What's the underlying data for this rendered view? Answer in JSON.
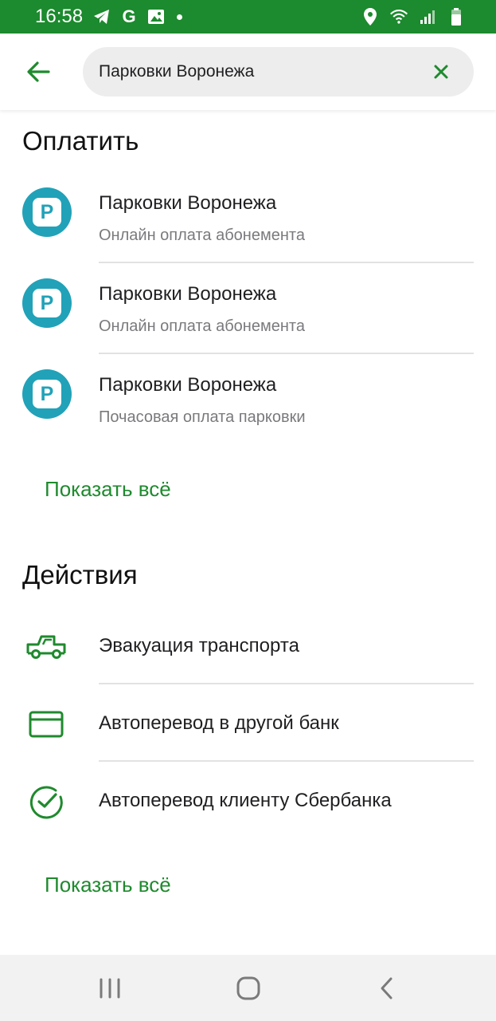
{
  "status_bar": {
    "time": "16:58",
    "left_icons": [
      "telegram-icon",
      "google-icon",
      "image-icon",
      "dot-icon"
    ],
    "right_icons": [
      "location-icon",
      "wifi-icon",
      "signal-icon",
      "battery-icon"
    ],
    "google_glyph": "G"
  },
  "search": {
    "value": "Парковки Воронежа",
    "placeholder": ""
  },
  "pay_section": {
    "title": "Оплатить",
    "items": [
      {
        "title": "Парковки Воронежа",
        "subtitle": "Онлайн оплата абонемента",
        "icon_letter": "P"
      },
      {
        "title": "Парковки Воронежа",
        "subtitle": "Онлайн оплата абонемента",
        "icon_letter": "P"
      },
      {
        "title": "Парковки Воронежа",
        "subtitle": "Почасовая оплата парковки",
        "icon_letter": "P"
      }
    ],
    "show_all": "Показать всё"
  },
  "actions_section": {
    "title": "Действия",
    "items": [
      {
        "title": "Эвакуация транспорта",
        "icon": "tow-truck-icon"
      },
      {
        "title": "Автоперевод в другой банк",
        "icon": "card-icon"
      },
      {
        "title": "Автоперевод клиенту Сбербанка",
        "icon": "check-circle-icon"
      }
    ],
    "show_all": "Показать всё"
  },
  "colors": {
    "status_bar": "#1c8a2e",
    "accent_green": "#1f8a2e",
    "parking_teal": "#21a2b8",
    "nav_bar": "#f2f2f2"
  },
  "nav_bar": {
    "buttons": [
      "recent-apps-icon",
      "home-icon",
      "back-icon"
    ]
  }
}
